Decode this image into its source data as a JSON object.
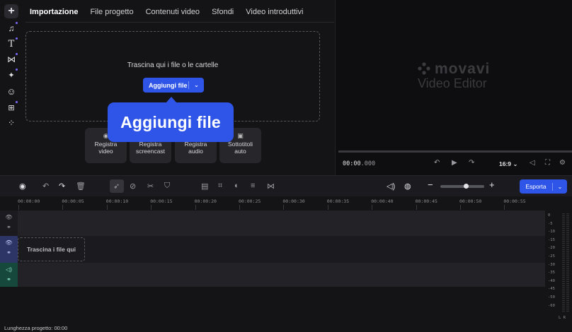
{
  "left_toolbar": {
    "items": [
      {
        "icon": "plus-icon",
        "glyph": "+"
      },
      {
        "icon": "music-icon",
        "glyph": "♫"
      },
      {
        "icon": "title-icon",
        "glyph": "T"
      },
      {
        "icon": "transition-icon",
        "glyph": "⋈"
      },
      {
        "icon": "magic-wand-icon",
        "glyph": "✦"
      },
      {
        "icon": "sticker-icon",
        "glyph": "☺"
      },
      {
        "icon": "animation-icon",
        "glyph": "⊞"
      },
      {
        "icon": "more-tools-icon",
        "glyph": "⁘"
      }
    ]
  },
  "import_panel": {
    "tabs": [
      "Importazione",
      "File progetto",
      "Contenuti video",
      "Sfondi",
      "Video introduttivi"
    ],
    "active_tab": "Importazione",
    "drop_text": "Trascina qui i file o le cartelle",
    "add_button": "Aggiungi file",
    "callout": "Aggiungi file",
    "record_buttons": [
      {
        "label_1": "Registra",
        "label_2": "video"
      },
      {
        "label_1": "Registra",
        "label_2": "screencast"
      },
      {
        "label_1": "Registra",
        "label_2": "audio"
      },
      {
        "label_1": "Sottotitoli",
        "label_2": "auto"
      }
    ]
  },
  "preview": {
    "logo_word": "movavi",
    "logo_sub": "Video Editor",
    "timecode_main": "00:00",
    "timecode_ms": ".000",
    "aspect_ratio": "16:9"
  },
  "timeline": {
    "export_button": "Esporta",
    "ruler_ticks": [
      "00:00:00",
      "00:00:05",
      "00:00:10",
      "00:00:15",
      "00:00:20",
      "00:00:25",
      "00:00:30",
      "00:00:35",
      "00:00:40",
      "00:00:45",
      "00:00:50",
      "00:00:55"
    ],
    "drop_here": "Trascina i file qui",
    "meter_labels": [
      "0",
      "-5",
      "-10",
      "-15",
      "-20",
      "-25",
      "-30",
      "-35",
      "-40",
      "-45",
      "-50",
      "-60"
    ],
    "meter_channels": "L  R"
  },
  "status": {
    "project_length": "Lunghezza progetto: 00:00"
  },
  "colors": {
    "accent": "#2f55e8",
    "background": "#141416",
    "track": "#232327"
  }
}
